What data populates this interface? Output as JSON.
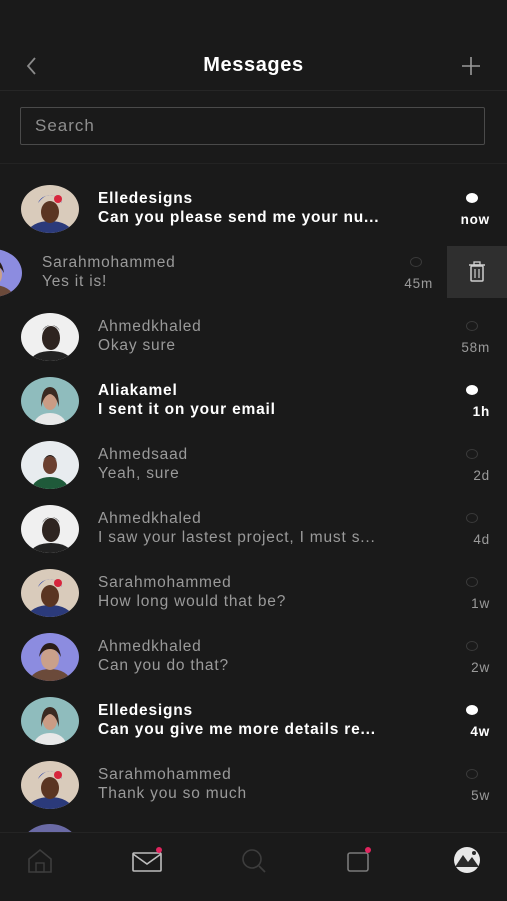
{
  "header": {
    "title": "Messages",
    "back_icon": "chevron-left-icon",
    "new_icon": "plus-icon"
  },
  "search": {
    "placeholder": "Search",
    "value": ""
  },
  "conversations": [
    {
      "name": "Elledesigns",
      "message": "Can you please send me your nu...",
      "time": "now",
      "unread": true
    },
    {
      "name": "Sarahmohammed",
      "message": "Yes it is!",
      "time": "45m",
      "unread": false,
      "swiped": true
    },
    {
      "name": "Ahmedkhaled",
      "message": "Okay sure",
      "time": "58m",
      "unread": false
    },
    {
      "name": "Aliakamel",
      "message": "I sent it on your email",
      "time": "1h",
      "unread": true
    },
    {
      "name": "Ahmedsaad",
      "message": "Yeah, sure",
      "time": "2d",
      "unread": false
    },
    {
      "name": "Ahmedkhaled",
      "message": "I saw your lastest project, I must s...",
      "time": "4d",
      "unread": false
    },
    {
      "name": "Sarahmohammed",
      "message": "How long would that be?",
      "time": "1w",
      "unread": false
    },
    {
      "name": "Ahmedkhaled",
      "message": "Can you do that?",
      "time": "2w",
      "unread": false
    },
    {
      "name": "Elledesigns",
      "message": "Can you give me more details re...",
      "time": "4w",
      "unread": true
    },
    {
      "name": "Sarahmohammed",
      "message": "Thank you so much",
      "time": "5w",
      "unread": false
    }
  ],
  "swipe_action": {
    "icon": "trash-icon"
  },
  "tabbar": {
    "tabs": [
      {
        "icon": "home-icon",
        "badge": false
      },
      {
        "icon": "mail-icon",
        "badge": true,
        "active": true
      },
      {
        "icon": "search-icon",
        "badge": false
      },
      {
        "icon": "notifications-icon",
        "badge": true
      },
      {
        "icon": "profile-avatar-icon",
        "badge": false
      }
    ]
  },
  "colors": {
    "background": "#1a1a1a",
    "badge": "#e0245e",
    "text_primary": "#ffffff",
    "text_secondary": "#9a9a9a"
  }
}
